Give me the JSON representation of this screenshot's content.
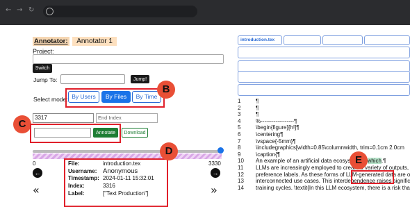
{
  "browser": {
    "nav_icons": [
      "back-icon",
      "forward-icon",
      "reload-icon"
    ],
    "back_glyph": "←",
    "forward_glyph": "→",
    "reload_glyph": "↻"
  },
  "annotator": {
    "label": "Annotator:",
    "name": "Annotator 1"
  },
  "project": {
    "label": "Project:",
    "value": ""
  },
  "switch_label": "Switch",
  "jump": {
    "label": "Jump To:",
    "value": "",
    "button": "Jump!"
  },
  "select_mode": {
    "label": "Select mode:",
    "options": [
      {
        "label": "By Users",
        "active": false
      },
      {
        "label": "By Files",
        "active": true
      },
      {
        "label": "By Time",
        "active": false
      }
    ]
  },
  "range": {
    "start_value": "3317",
    "end_placeholder": "End Index"
  },
  "annotate": {
    "button": "Annotate",
    "download": "Download"
  },
  "slider": {
    "min": "0",
    "max": "3330",
    "value_fraction": 0.995
  },
  "nav_arrows": {
    "prev": "←",
    "next": "→",
    "first": "«",
    "last": "»"
  },
  "info": {
    "file_key": "File:",
    "file_val": "introduction.tex",
    "username_key": "Username:",
    "username_val": "Anonymous",
    "timestamp_key": "Timestamp:",
    "timestamp_val": "2024-01-11 15:32:01",
    "index_key": "Index:",
    "index_val": "3316",
    "label_key": "Label:",
    "label_val": "[\"Text Production\"]"
  },
  "callouts": {
    "b": "B",
    "c": "C",
    "d": "D",
    "e": "E"
  },
  "editor": {
    "active_tab": "introduction.tex",
    "lines": [
      {
        "n": "1",
        "text": "¶"
      },
      {
        "n": "2",
        "text": "¶"
      },
      {
        "n": "3",
        "text": "¶"
      },
      {
        "n": "4",
        "text": "%------------------¶"
      },
      {
        "n": "5",
        "text": "\\begin{figure}[h!]¶"
      },
      {
        "n": "6",
        "text": "\\centering¶"
      },
      {
        "n": "7",
        "text": "\\vspace{-5mm}¶"
      },
      {
        "n": "8",
        "text": "\\includegraphics[width=0.85\\columnwidth, trim=0.1cm 2.0cm"
      },
      {
        "n": "9",
        "text": "\\caption{¶"
      },
      {
        "n": "10",
        "text_pre": "An example of an artificial data ecosystem in ",
        "text_hl": "which",
        "text_post": ".¶"
      },
      {
        "n": "11",
        "text": "LLMs are increasingly employed to create a variety of outputs, in"
      },
      {
        "n": "12",
        "text": "preference labels. As these forms of LLM-generated data are oft"
      },
      {
        "n": "13",
        "text": "interconnected use cases. This interdependence raises significa"
      },
      {
        "n": "14",
        "text": "training cycles. \\textit{In this LLM ecosystem, there is a risk that"
      }
    ]
  },
  "colors": {
    "accent": "#1a73e8",
    "callout": "#e94f36",
    "outline": "#e0202a",
    "annotate": "#1e7e34"
  }
}
